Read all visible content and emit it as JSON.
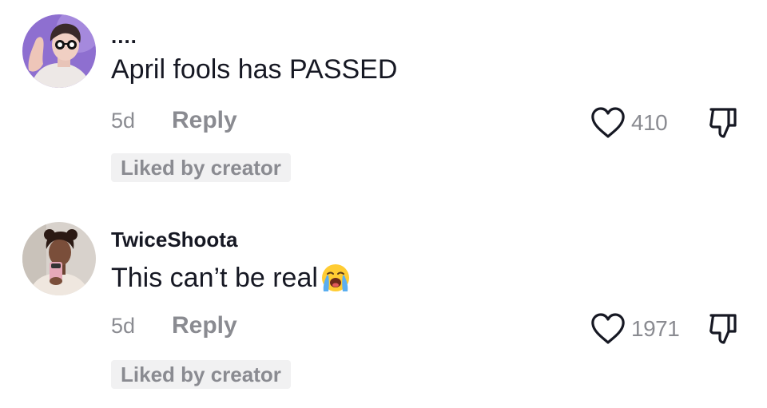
{
  "comments": [
    {
      "username": "....",
      "text": "April fools has PASSED",
      "emoji": "",
      "time": "5d",
      "reply_label": "Reply",
      "likes": "410",
      "badge": "Liked by creator"
    },
    {
      "username": "TwiceShoota",
      "text": "This can’t be real",
      "emoji": "loudly-crying-face",
      "time": "5d",
      "reply_label": "Reply",
      "likes": "1971",
      "badge": "Liked by creator"
    }
  ],
  "colors": {
    "primary_text": "#161823",
    "secondary_text": "#8a8b91",
    "badge_bg": "#f1f1f2",
    "avatar1_bg": "#8e6fd0",
    "avatar2_bg": "#d8d2cc"
  },
  "icons": {
    "like": "heart-outline-icon",
    "dislike": "thumbs-down-outline-icon"
  }
}
